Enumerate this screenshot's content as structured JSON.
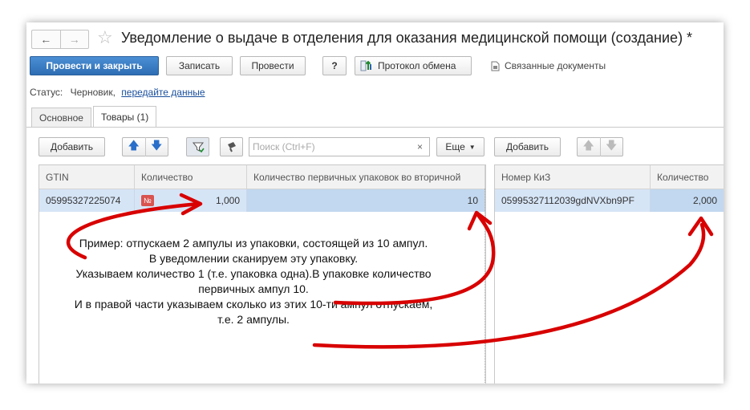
{
  "window": {
    "title": "Уведомление о выдаче в отделения для оказания медицинской помощи (создание) *"
  },
  "toolbar": {
    "post_close": "Провести и закрыть",
    "save": "Записать",
    "post": "Провести",
    "help": "?",
    "exchange_log": "Протокол обмена",
    "related_docs": "Связанные документы"
  },
  "status": {
    "label": "Статус:",
    "value": "Черновик,",
    "link": "передайте данные"
  },
  "tabs": [
    {
      "label": "Основное"
    },
    {
      "label": "Товары (1)"
    }
  ],
  "left_panel": {
    "add_label": "Добавить",
    "search_placeholder": "Поиск (Ctrl+F)",
    "clear": "×",
    "more_label": "Еще",
    "columns": [
      "GTIN",
      "Количество",
      "Количество первичных упаковок во вторичной"
    ],
    "rows": [
      {
        "gtin": "05995327225074",
        "badge": "№",
        "qty": "1,000",
        "primary_qty": "10"
      }
    ]
  },
  "right_panel": {
    "add_label": "Добавить",
    "columns": [
      "Номер КиЗ",
      "Количество"
    ],
    "rows": [
      {
        "kiz": "05995327112039gdNVXbn9PF",
        "qty": "2,000"
      }
    ]
  },
  "annotation": {
    "lines": [
      "Пример: отпускаем 2 ампулы из упаковки, состоящей из 10 ампул.",
      "В уведомлении сканируем эту упаковку.",
      "Указываем количество 1 (т.е. упаковка одна).В упаковке количество",
      "первичных ампул 10.",
      "И в правой части указываем сколько из этих 10-ти ампул отпускаем,",
      "т.е. 2 ампулы."
    ]
  },
  "colors": {
    "primary_button": "#2e6db3",
    "selected_row": "#d6e5f6",
    "annotation_arrow": "#d80000",
    "link": "#1a4f9c"
  }
}
